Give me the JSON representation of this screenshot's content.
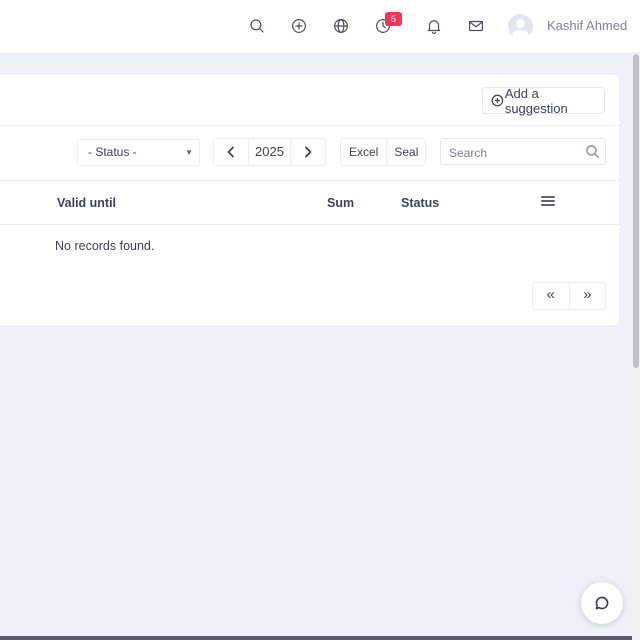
{
  "topbar": {
    "icons": [
      "search-icon",
      "plus-circle-icon",
      "globe-icon",
      "clock-icon",
      "bell-icon",
      "mail-icon"
    ],
    "clock_badge": "5",
    "user_name": "Kashif Ahmed"
  },
  "toolbar": {
    "add_suggestion_label": "Add a suggestion",
    "status_select_value": "- Status -",
    "year": "2025",
    "excel_label": "Excel",
    "seal_label": "Seal",
    "search_placeholder": "Search"
  },
  "table": {
    "headers": [
      "Valid until",
      "Sum",
      "Status"
    ],
    "empty_message": "No records found."
  },
  "pagination": {
    "first_label": "«",
    "last_label": "»"
  },
  "colors": {
    "background": "#eff0f9",
    "badge": "#f0355a"
  }
}
